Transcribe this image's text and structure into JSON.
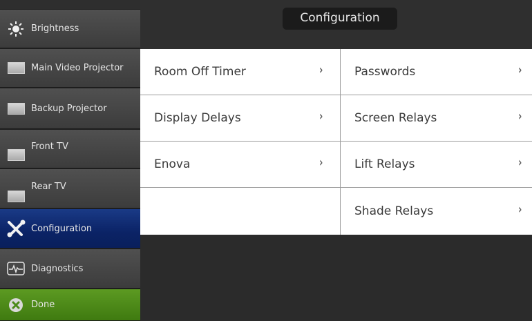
{
  "sidebar": {
    "items": [
      {
        "label": "Brightness",
        "icon": "sun-icon"
      },
      {
        "label": "Main Video Projector",
        "icon": "screen-icon"
      },
      {
        "label": "Backup Projector",
        "icon": "screen-icon"
      },
      {
        "label": "Front TV",
        "icon": "screen-icon"
      },
      {
        "label": "Rear TV",
        "icon": "screen-icon"
      },
      {
        "label": "Configuration",
        "icon": "tools-icon"
      },
      {
        "label": "Diagnostics",
        "icon": "pulse-icon"
      },
      {
        "label": "Done",
        "icon": "close-circle-icon"
      }
    ]
  },
  "header": {
    "title": "Configuration"
  },
  "menu": {
    "left": [
      {
        "label": "Room Off Timer",
        "chevron": "›"
      },
      {
        "label": "Display Delays",
        "chevron": "›"
      },
      {
        "label": "Enova",
        "chevron": "›"
      }
    ],
    "right": [
      {
        "label": "Passwords",
        "chevron": "›"
      },
      {
        "label": "Screen Relays",
        "chevron": "›"
      },
      {
        "label": "Lift Relays",
        "chevron": "›"
      },
      {
        "label": "Shade Relays",
        "chevron": "›"
      }
    ]
  },
  "colors": {
    "active": "#0b2366",
    "done": "#4a8a18"
  }
}
